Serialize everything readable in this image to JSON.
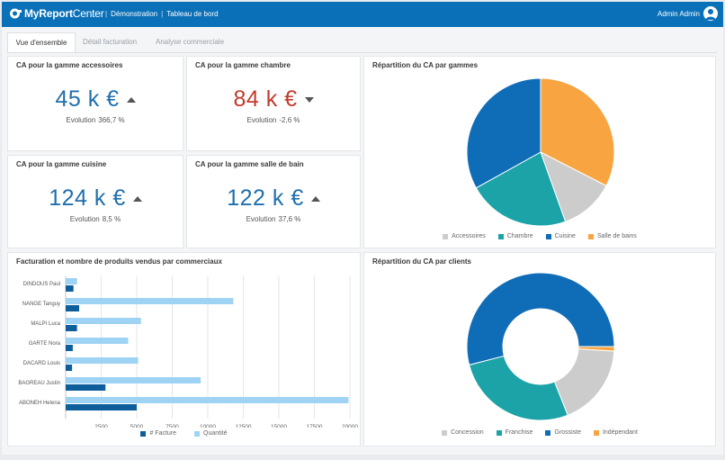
{
  "app": {
    "brand_main": "MyReport",
    "brand_sub": "Center",
    "crumbs": [
      "Démonstration",
      "Tableau de bord"
    ],
    "user": "Admin Admin",
    "accent_color": "#0a70b8"
  },
  "tabs": [
    {
      "label": "Vue d'ensemble",
      "active": true
    },
    {
      "label": "Détail facturation",
      "active": false
    },
    {
      "label": "Analyse commerciale",
      "active": false
    }
  ],
  "kpis": [
    {
      "title": "CA pour la gamme accessoires",
      "value": "45 k €",
      "trend": "up",
      "evo_label": "Evolution",
      "evo_value": "366,7 %"
    },
    {
      "title": "CA pour la gamme chambre",
      "value": "84 k €",
      "trend": "down",
      "evo_label": "Evolution",
      "evo_value": "-2,6 %"
    },
    {
      "title": "CA pour la gamme cuisine",
      "value": "124 k €",
      "trend": "up",
      "evo_label": "Evolution",
      "evo_value": "8,5 %"
    },
    {
      "title": "CA pour la gamme salle de bain",
      "value": "122 k €",
      "trend": "up",
      "evo_label": "Evolution",
      "evo_value": "37,6 %"
    }
  ],
  "chart_data": [
    {
      "type": "pie",
      "title": "Répartition du CA par gammes",
      "labels": [
        "Accessoires",
        "Chambre",
        "Cuisine",
        "Salle de bains"
      ],
      "values": [
        45,
        84,
        124,
        122
      ],
      "colors": [
        "#cccccc",
        "#1ba3a8",
        "#0f6db8",
        "#f8a440"
      ],
      "legend": "bottom"
    },
    {
      "type": "bar",
      "orientation": "horizontal",
      "title": "Facturation et nombre de produits vendus par commerciaux",
      "categories": [
        "DINDOUS Paul",
        "NANGE Tanguy",
        "MALPI Luca",
        "GARTE Nora",
        "DACARD Louis",
        "BAGREAU Justin",
        "ABONEH Helena"
      ],
      "series": [
        {
          "name": "# Facture",
          "values": [
            550,
            950,
            800,
            500,
            450,
            2800,
            5000
          ],
          "color": "#0f5e9c"
        },
        {
          "name": "Quantité",
          "values": [
            800,
            11800,
            5300,
            4400,
            5100,
            9500,
            19900
          ],
          "color": "#9fd3f3"
        }
      ],
      "xticks": [
        2500,
        5000,
        7500,
        10000,
        12500,
        15000,
        17500,
        20000
      ],
      "xlim": [
        0,
        20000
      ],
      "grid": true,
      "legend": "bottom"
    },
    {
      "type": "pie",
      "donut": true,
      "title": "Répartition du CA par clients",
      "labels": [
        "Concession",
        "Franchise",
        "Grossiste",
        "Indépendant"
      ],
      "values": [
        18,
        27,
        54,
        1
      ],
      "colors": [
        "#cccccc",
        "#1ba3a8",
        "#0f6db8",
        "#f8a440"
      ],
      "legend": "bottom"
    }
  ]
}
